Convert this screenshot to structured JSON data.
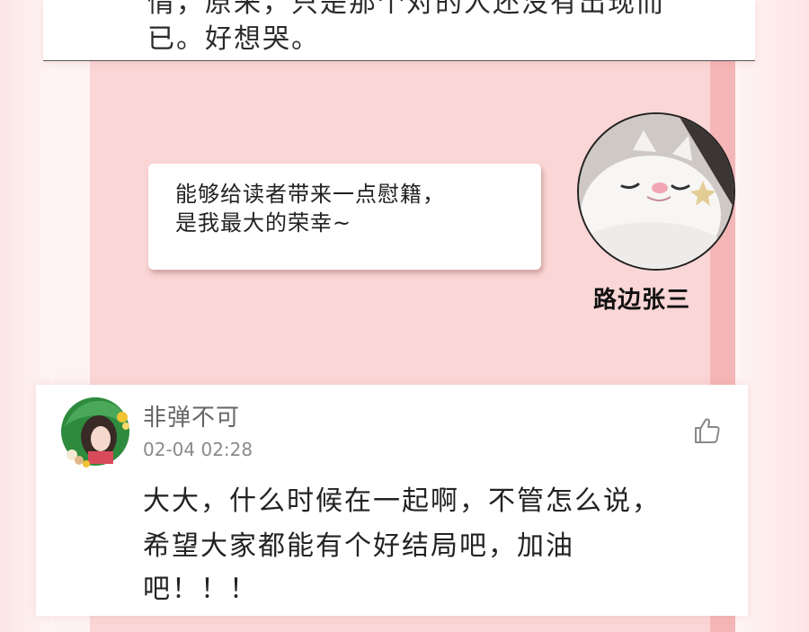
{
  "top_comment": {
    "line1_partial": "情，原来，只是那个对的人还没有出现而",
    "line2": "已。好想哭。"
  },
  "panel": {
    "bubble": {
      "line1": "能够给读者带来一点慰籍，",
      "line2": "是我最大的荣幸~"
    },
    "author_name": "路边张三"
  },
  "comment": {
    "username": "非弹不可",
    "timestamp": "02-04 02:28",
    "body_line1": "大大，什么时候在一起啊，不管怎么说，",
    "body_line2": "希望大家都能有个好结局吧，加油",
    "body_line3": "吧！！！",
    "like_icon": "thumbs-up-icon"
  },
  "colors": {
    "panel_pink": "#fbd6d6",
    "panel_stripe": "#f4b6b6",
    "comment_text": "#222222",
    "meta_text": "#8a8a8a"
  }
}
